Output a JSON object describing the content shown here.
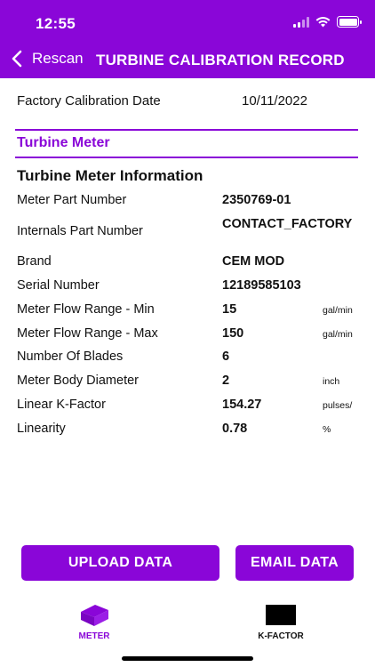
{
  "status_bar": {
    "time": "12:55"
  },
  "nav": {
    "back_label": "Rescan",
    "title": "TURBINE CALIBRATION RECORD"
  },
  "calibration": {
    "label": "Factory Calibration Date",
    "value": "10/11/2022"
  },
  "section": {
    "title": "Turbine Meter"
  },
  "info": {
    "heading": "Turbine Meter Information",
    "rows": [
      {
        "label": "Meter Part Number",
        "value": "2350769-01",
        "unit": ""
      },
      {
        "label": "Internals Part Number",
        "value": "CONTACT_FACTORY",
        "unit": ""
      },
      {
        "label": "Brand",
        "value": "CEM MOD",
        "unit": ""
      },
      {
        "label": "Serial Number",
        "value": "12189585103",
        "unit": ""
      },
      {
        "label": "Meter Flow Range - Min",
        "value": "15",
        "unit": "gal/min"
      },
      {
        "label": "Meter Flow Range - Max",
        "value": "150",
        "unit": "gal/min"
      },
      {
        "label": "Number Of Blades",
        "value": "6",
        "unit": ""
      },
      {
        "label": "Meter Body Diameter",
        "value": "2",
        "unit": "inch"
      },
      {
        "label": "Linear K-Factor",
        "value": "154.27",
        "unit": "pulses/"
      },
      {
        "label": "Linearity",
        "value": "0.78",
        "unit": "%"
      }
    ]
  },
  "buttons": {
    "upload": "UPLOAD DATA",
    "email": "EMAIL DATA"
  },
  "tabs": {
    "meter": {
      "label": "METER",
      "icon": "book-icon"
    },
    "kfactor": {
      "label": "K-FACTOR",
      "icon": "rectangle-icon"
    }
  },
  "colors": {
    "accent": "#8a06d8"
  }
}
